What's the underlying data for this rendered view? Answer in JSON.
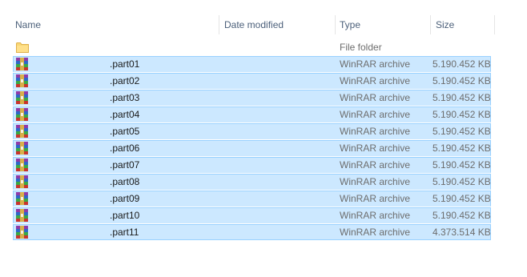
{
  "columns": {
    "name": "Name",
    "date_modified": "Date modified",
    "type": "Type",
    "size": "Size"
  },
  "folder_row": {
    "name": "",
    "type": "File folder",
    "icon": "folder-icon"
  },
  "files": [
    {
      "name": ".part01",
      "type": "WinRAR archive",
      "size": "5.190.452 KB",
      "icon": "winrar-archive-icon"
    },
    {
      "name": ".part02",
      "type": "WinRAR archive",
      "size": "5.190.452 KB",
      "icon": "winrar-archive-icon"
    },
    {
      "name": ".part03",
      "type": "WinRAR archive",
      "size": "5.190.452 KB",
      "icon": "winrar-archive-icon"
    },
    {
      "name": ".part04",
      "type": "WinRAR archive",
      "size": "5.190.452 KB",
      "icon": "winrar-archive-icon"
    },
    {
      "name": ".part05",
      "type": "WinRAR archive",
      "size": "5.190.452 KB",
      "icon": "winrar-archive-icon"
    },
    {
      "name": ".part06",
      "type": "WinRAR archive",
      "size": "5.190.452 KB",
      "icon": "winrar-archive-icon"
    },
    {
      "name": ".part07",
      "type": "WinRAR archive",
      "size": "5.190.452 KB",
      "icon": "winrar-archive-icon"
    },
    {
      "name": ".part08",
      "type": "WinRAR archive",
      "size": "5.190.452 KB",
      "icon": "winrar-archive-icon"
    },
    {
      "name": ".part09",
      "type": "WinRAR archive",
      "size": "5.190.452 KB",
      "icon": "winrar-archive-icon"
    },
    {
      "name": ".part10",
      "type": "WinRAR archive",
      "size": "5.190.452 KB",
      "icon": "winrar-archive-icon"
    },
    {
      "name": ".part11",
      "type": "WinRAR archive",
      "size": "4.373.514 KB",
      "icon": "winrar-archive-icon"
    }
  ],
  "colors": {
    "selection_fill": "#cce8ff",
    "selection_border": "#99d1ff",
    "header_text": "#4c607a"
  }
}
